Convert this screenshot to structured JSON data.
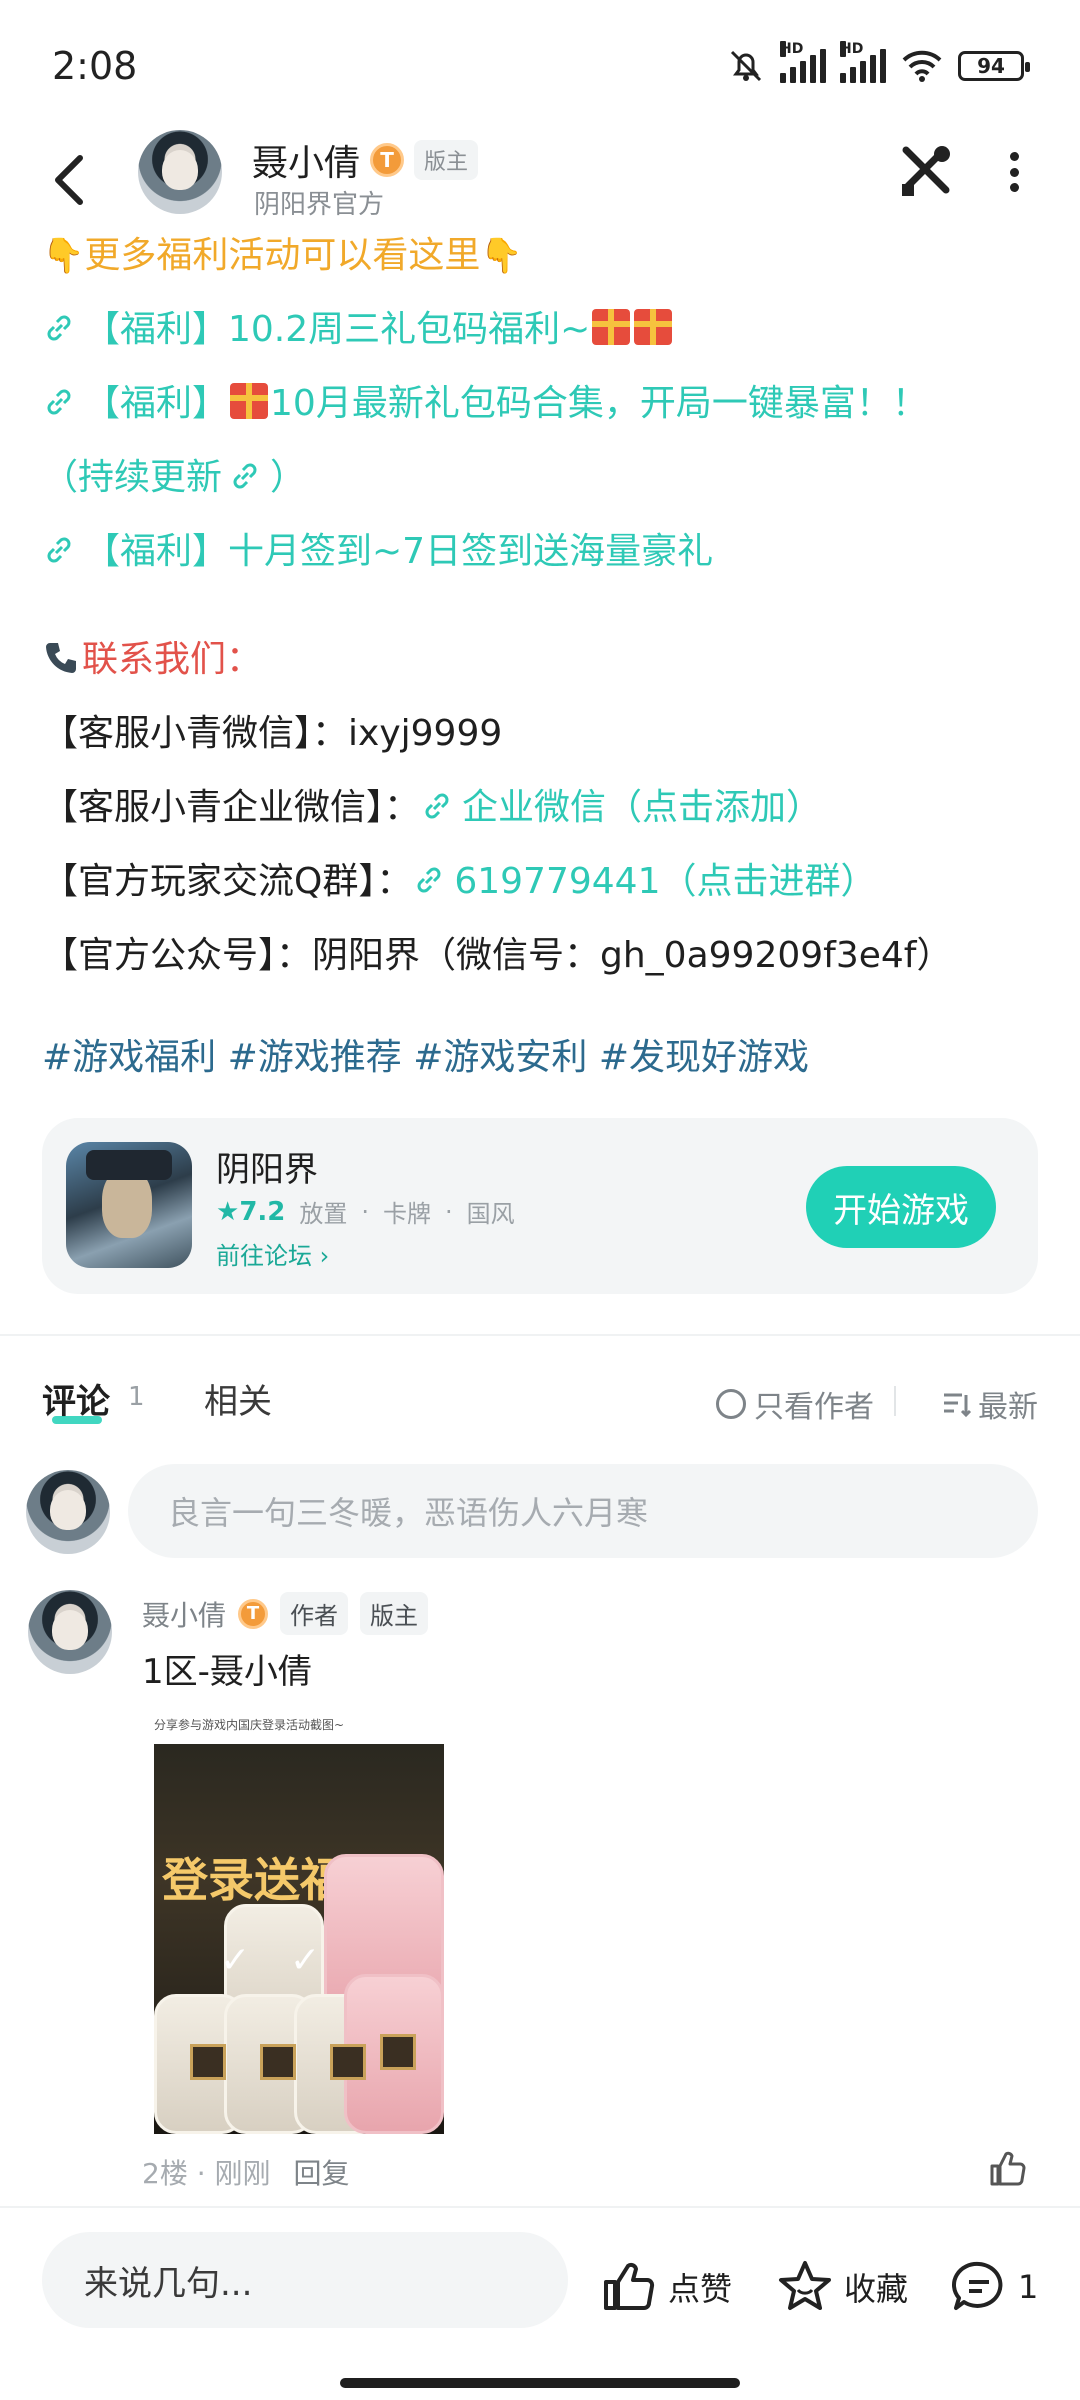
{
  "status_bar": {
    "time": "2:08",
    "battery": "94",
    "hd1": "HD",
    "hd2": "HD"
  },
  "header": {
    "author_name": "聂小倩",
    "level_badge": "T",
    "role_tag": "版主",
    "subtitle": "阴阳界官方"
  },
  "post": {
    "promo_line": "更多福利活动可以看这里",
    "links": [
      {
        "text": "【福利】10.2周三礼包码福利~"
      },
      {
        "text_a": "【福利】",
        "text_b": "10月最新礼包码合集，开局一键暴富！！",
        "text_c": "（持续更新",
        "text_d": "）"
      },
      {
        "text": "【福利】十月签到~7日签到送海量豪礼"
      }
    ],
    "contact_title": "联系我们：",
    "contacts": [
      {
        "label": "【客服小青微信】：",
        "value": "ixyj9999"
      },
      {
        "label": "【客服小青企业微信】：",
        "value": "企业微信（点击添加）"
      },
      {
        "label": "【官方玩家交流Q群】：",
        "value": "619779441（点击进群）"
      },
      {
        "label": "【官方公众号】：",
        "value": "阴阳界（微信号：gh_0a99209f3e4f）"
      }
    ],
    "hashtags": [
      "#游戏福利",
      "#游戏推荐",
      "#游戏安利",
      "#发现好游戏"
    ]
  },
  "game_card": {
    "name": "阴阳界",
    "rating": "7.2",
    "tags": [
      "放置",
      "卡牌",
      "国风"
    ],
    "forum_link": "前往论坛",
    "start_button": "开始游戏"
  },
  "comments_header": {
    "tab_comments": "评论",
    "comment_count": "1",
    "tab_related": "相关",
    "only_author": "只看作者",
    "sort_newest": "最新"
  },
  "comment_input": {
    "placeholder": "良言一句三冬暖，恶语伤人六月寒"
  },
  "comment": {
    "name": "聂小倩",
    "level_badge": "T",
    "tag_author": "作者",
    "tag_mod": "版主",
    "text": "1区-聂小倩",
    "image_caption": "分享参与游戏内国庆登录活动截图~",
    "image_banner": "登录送福利",
    "floor": "2楼",
    "time": "刚刚",
    "reply": "回复"
  },
  "bottom_bar": {
    "input_placeholder": "来说几句...",
    "like": "点赞",
    "favorite": "收藏",
    "comment_count": "1"
  },
  "colors": {
    "accent": "#20d0b6",
    "link": "#2ec9b6",
    "promo": "#f1a92a",
    "contact": "#e2524a",
    "hashtag": "#2c6a8e"
  }
}
